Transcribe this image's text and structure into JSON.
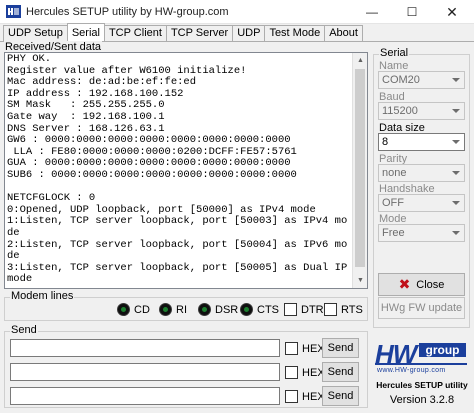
{
  "window": {
    "title": "Hercules SETUP utility by HW-group.com",
    "minimize_glyph": "—",
    "maximize_glyph": "☐",
    "close_glyph": "✕"
  },
  "tabs": [
    {
      "label": "UDP Setup",
      "active": false
    },
    {
      "label": "Serial",
      "active": true
    },
    {
      "label": "TCP Client",
      "active": false
    },
    {
      "label": "TCP Server",
      "active": false
    },
    {
      "label": "UDP",
      "active": false
    },
    {
      "label": "Test Mode",
      "active": false
    },
    {
      "label": "About",
      "active": false
    }
  ],
  "received": {
    "group_label": "Received/Sent data",
    "text": "PHY OK.\nRegister value after W6100 initialize!\nMac address: de:ad:be:ef:fe:ed\nIP address : 192.168.100.152\nSM Mask   : 255.255.255.0\nGate way  : 192.168.100.1\nDNS Server : 168.126.63.1\nGW6 : 0000:0000:0000:0000:0000:0000:0000:0000\n LLA : FE80:0000:0000:0000:0200:DCFF:FE57:5761\nGUA : 0000:0000:0000:0000:0000:0000:0000:0000\nSUB6 : 0000:0000:0000:0000:0000:0000:0000:0000\n\nNETCFGLOCK : 0\n0:Opened, UDP loopback, port [50000] as IPv4 mode\n1:Listen, TCP server loopback, port [50003] as IPv4 mode\n2:Listen, TCP server loopback, port [50004] as IPv6 mode\n3:Listen, TCP server loopback, port [50005] as Dual IP mode"
  },
  "modem_lines": {
    "group_label": "Modem lines",
    "indicators": [
      "CD",
      "RI",
      "DSR",
      "CTS"
    ],
    "checkboxes": [
      "DTR",
      "RTS"
    ]
  },
  "send": {
    "group_label": "Send",
    "rows": [
      {
        "value": "",
        "hex_label": "HEX",
        "button_label": "Send"
      },
      {
        "value": "",
        "hex_label": "HEX",
        "button_label": "Send"
      },
      {
        "value": "",
        "hex_label": "HEX",
        "button_label": "Send"
      }
    ]
  },
  "serial": {
    "group_label": "Serial",
    "name": {
      "label": "Name",
      "value": "COM20",
      "enabled": false
    },
    "baud": {
      "label": "Baud",
      "value": "115200",
      "enabled": false
    },
    "data_size": {
      "label": "Data size",
      "value": "8",
      "enabled": true
    },
    "parity": {
      "label": "Parity",
      "value": "none",
      "enabled": false
    },
    "handshake": {
      "label": "Handshake",
      "value": "OFF",
      "enabled": false
    },
    "mode": {
      "label": "Mode",
      "value": "Free",
      "enabled": false
    },
    "close_label": "Close",
    "hwg_fw_label": "HWg FW update"
  },
  "branding": {
    "logo_hw": "HW",
    "logo_group": "group",
    "logo_url": "www.HW-group.com",
    "product": "Hercules SETUP utility",
    "version": "Version  3.2.8"
  },
  "colors": {
    "accent_blue": "#1b3f9c",
    "close_icon_red": "#c0101a",
    "lamp_green": "#1c7f2e"
  }
}
